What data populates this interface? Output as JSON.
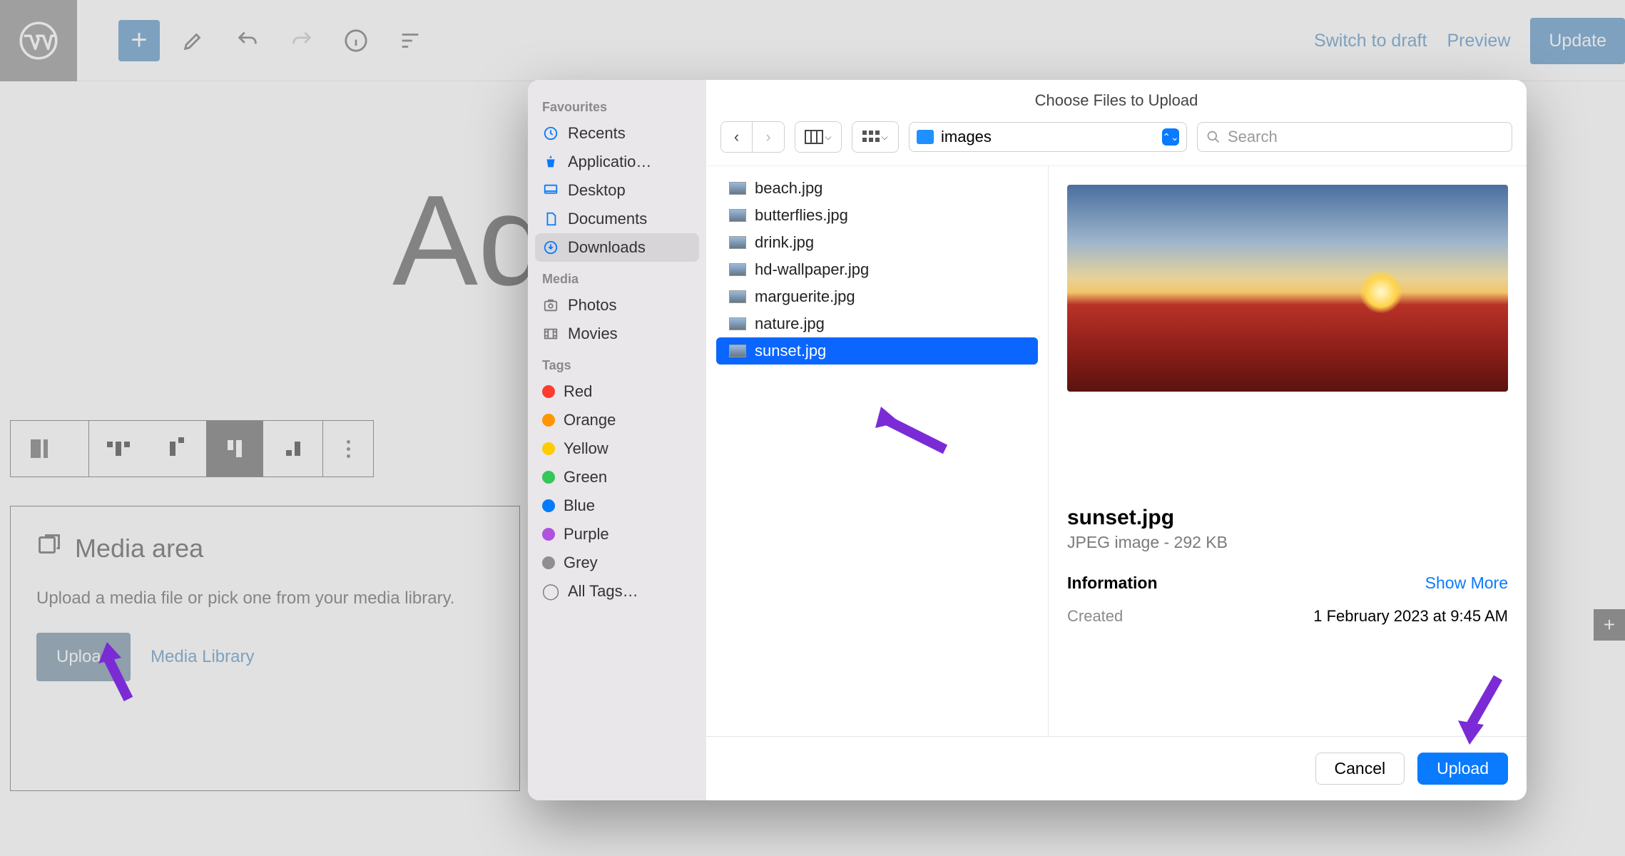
{
  "toolbar": {
    "switch_draft": "Switch to draft",
    "preview": "Preview",
    "update": "Update"
  },
  "page": {
    "title_fragment": "Ad",
    "media_block": {
      "title": "Media area",
      "description": "Upload a media file or pick one from your media library.",
      "upload": "Upload",
      "library": "Media Library"
    }
  },
  "dialog": {
    "title": "Choose Files to Upload",
    "location": "images",
    "search_placeholder": "Search",
    "sidebar": {
      "favourites_label": "Favourites",
      "favourites": [
        "Recents",
        "Applicatio…",
        "Desktop",
        "Documents",
        "Downloads"
      ],
      "media_label": "Media",
      "media": [
        "Photos",
        "Movies"
      ],
      "tags_label": "Tags",
      "tags": [
        {
          "label": "Red",
          "color": "#ff3b30"
        },
        {
          "label": "Orange",
          "color": "#ff9500"
        },
        {
          "label": "Yellow",
          "color": "#ffcc00"
        },
        {
          "label": "Green",
          "color": "#34c759"
        },
        {
          "label": "Blue",
          "color": "#007aff"
        },
        {
          "label": "Purple",
          "color": "#af52de"
        },
        {
          "label": "Grey",
          "color": "#8e8e93"
        }
      ],
      "all_tags": "All Tags…"
    },
    "files": [
      "beach.jpg",
      "butterflies.jpg",
      "drink.jpg",
      "hd-wallpaper.jpg",
      "marguerite.jpg",
      "nature.jpg",
      "sunset.jpg"
    ],
    "selected_file": "sunset.jpg",
    "detail": {
      "name": "sunset.jpg",
      "type": "JPEG image - 292 KB",
      "info_label": "Information",
      "show_more": "Show More",
      "created_label": "Created",
      "created_value": "1 February 2023 at 9:45 AM"
    },
    "footer": {
      "cancel": "Cancel",
      "upload": "Upload"
    }
  }
}
